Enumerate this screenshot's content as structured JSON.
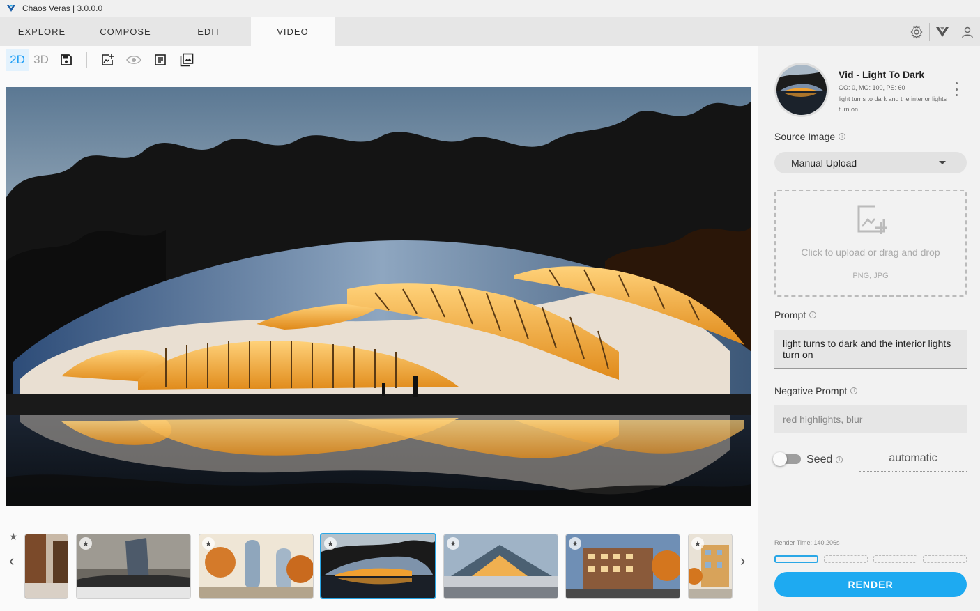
{
  "window": {
    "title": "Chaos Veras | 3.0.0.0"
  },
  "nav": {
    "tabs": [
      "EXPLORE",
      "COMPOSE",
      "EDIT",
      "VIDEO"
    ],
    "active_tab": "VIDEO"
  },
  "toolbar": {
    "mode_2d": "2D",
    "mode_3d": "3D"
  },
  "preset": {
    "title": "Vid - Light To Dark",
    "meta": "GO: 0, MO: 100, PS: 60",
    "description": "light turns to dark and the interior lights turn on"
  },
  "source_image": {
    "label": "Source Image",
    "selected": "Manual Upload"
  },
  "upload": {
    "text": "Click to upload or drag and drop",
    "formats": "PNG, JPG"
  },
  "prompt": {
    "label": "Prompt",
    "value": "light turns to dark and the interior lights turn on"
  },
  "negative_prompt": {
    "label": "Negative Prompt",
    "value": "red highlights, blur"
  },
  "seed": {
    "label": "Seed",
    "value": "automatic",
    "enabled": false
  },
  "render": {
    "time": "Render Time: 140.206s",
    "button": "RENDER"
  },
  "colors": {
    "accent": "#1eaaf1",
    "active_tab_bg": "#fafafa",
    "navbar_bg": "#e6e6e6"
  },
  "icons": [
    "veras-logo-icon",
    "save-icon",
    "add-image-icon",
    "eye-icon",
    "document-icon",
    "gallery-icon",
    "gear-icon",
    "user-icon",
    "info-icon",
    "star-icon",
    "chevron-left-icon",
    "chevron-right-icon",
    "kebab-menu-icon",
    "upload-image-icon"
  ]
}
